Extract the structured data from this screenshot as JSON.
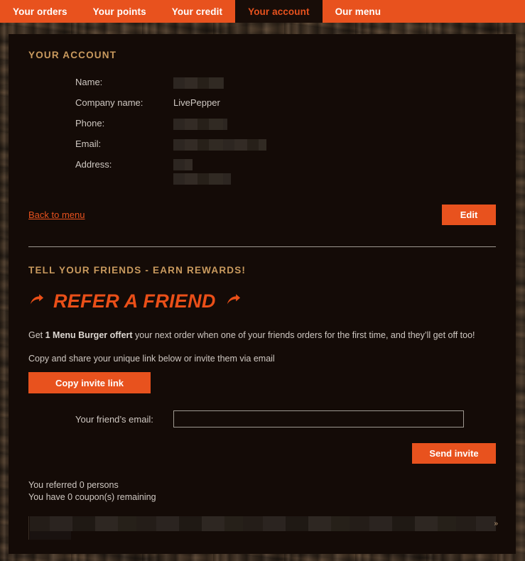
{
  "theme": {
    "accent": "#e8521e",
    "heading_gold": "#c99a5e",
    "panel_bg": "#140b07",
    "body_text": "#cfc8c2",
    "divider": "#9e9890"
  },
  "nav": {
    "items": [
      {
        "label": "Your orders",
        "active": false
      },
      {
        "label": "Your points",
        "active": false
      },
      {
        "label": "Your credit",
        "active": false
      },
      {
        "label": "Your account",
        "active": true
      },
      {
        "label": "Our menu",
        "active": false
      }
    ]
  },
  "account": {
    "title": "YOUR ACCOUNT",
    "fields": [
      {
        "label": "Name:",
        "value": "",
        "redacted": true
      },
      {
        "label": "Company name:",
        "value": "LivePepper",
        "redacted": false
      },
      {
        "label": "Phone:",
        "value": "",
        "redacted": true
      },
      {
        "label": "Email:",
        "value": "",
        "redacted": true
      },
      {
        "label": "Address:",
        "value": "",
        "redacted": true
      }
    ],
    "back_link": "Back to menu",
    "edit_button": "Edit"
  },
  "refer": {
    "kicker": "TELL YOUR FRIENDS - EARN REWARDS!",
    "title": "REFER A FRIEND",
    "left_arrow_icon": "share-arrow-icon",
    "right_arrow_icon": "share-arrow-icon",
    "offer_prefix": "Get ",
    "offer_bold": "1 Menu Burger offert",
    "offer_suffix": " your next order when one of your friends orders for the first time, and they’ll get off too!",
    "copy_hint": "Copy and share your unique link below or invite them via email",
    "copy_button": "Copy invite link",
    "email_label": "Your friend’s email:",
    "email_value": "",
    "email_placeholder": "",
    "send_button": "Send invite",
    "referred_line": "You referred 0 persons",
    "coupons_line": "You have 0 coupon(s) remaining",
    "invite_link_redacted": true
  }
}
